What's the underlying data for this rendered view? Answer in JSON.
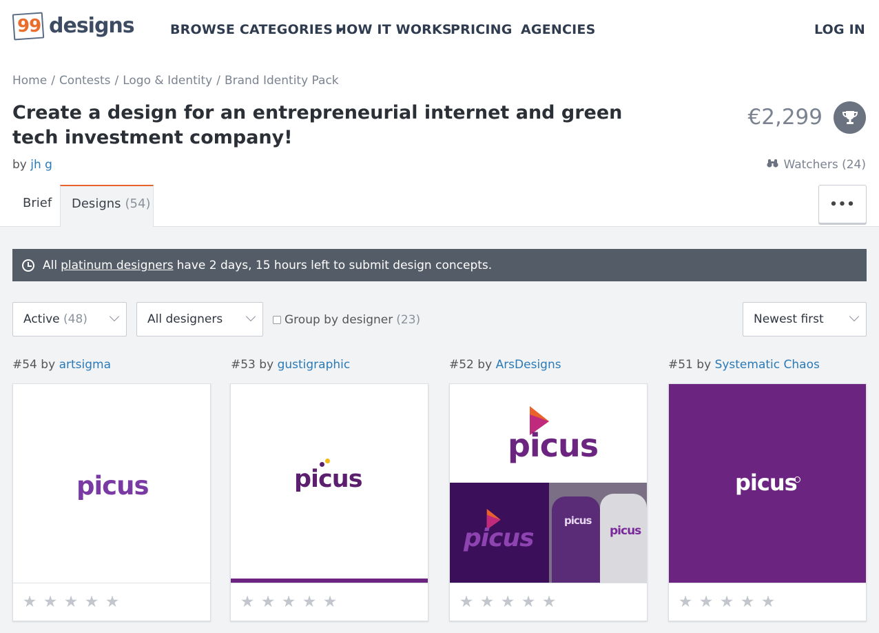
{
  "header": {
    "logo_number": "99",
    "logo_word": "designs",
    "nav": {
      "browse": "BROWSE CATEGORIES",
      "how": "HOW IT WORKS",
      "pricing": "PRICING",
      "agencies": "AGENCIES",
      "login": "LOG IN"
    }
  },
  "breadcrumb": {
    "items": [
      "Home",
      "Contests",
      "Logo & Identity",
      "Brand Identity Pack"
    ],
    "separator": "/"
  },
  "contest": {
    "title": "Create a design for an entrepreneurial internet and green tech investment company!",
    "by_prefix": "by",
    "author": "jh g",
    "price": "€2,299",
    "watchers": "Watchers (24)"
  },
  "tabs": {
    "brief": "Brief",
    "designs": "Designs",
    "designs_count": "(54)",
    "more": "•••"
  },
  "alert": {
    "prefix": "All",
    "link": "platinum designers",
    "suffix": "have 2 days, 15 hours left to submit design concepts."
  },
  "filters": {
    "status_label": "Active",
    "status_count": "(48)",
    "designers": "All designers",
    "group_label": "Group by designer",
    "group_count": "(23)",
    "sort": "Newest first"
  },
  "cards": [
    {
      "number": "#54",
      "by": "by",
      "designer": "artsigma",
      "logo_text": "picus"
    },
    {
      "number": "#53",
      "by": "by",
      "designer": "gustigraphic",
      "logo_text": "picus"
    },
    {
      "number": "#52",
      "by": "by",
      "designer": "ArsDesigns",
      "logo_text": "picus"
    },
    {
      "number": "#51",
      "by": "by",
      "designer": "Systematic Chaos",
      "logo_text": "picus"
    }
  ],
  "colors": {
    "accent": "#e9622b",
    "link": "#2a7ab7",
    "brand_purple": "#6b2580"
  },
  "rating": {
    "stars": 5,
    "filled": 0
  }
}
